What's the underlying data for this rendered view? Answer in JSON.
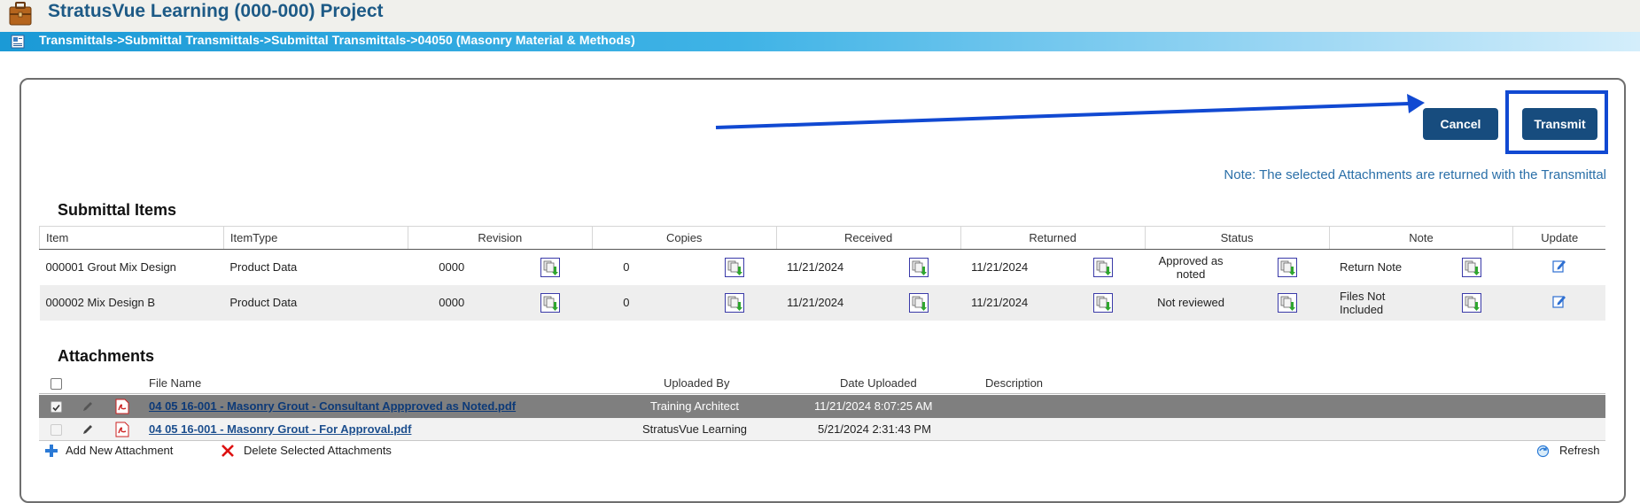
{
  "app": {
    "title": "StratusVue Learning (000-000) Project"
  },
  "breadcrumb": "Transmittals->Submittal Transmittals->Submittal Transmittals->04050 (Masonry Material & Methods)",
  "actions": {
    "cancel_label": "Cancel",
    "transmit_label": "Transmit"
  },
  "note": "Note: The selected Attachments are returned with the Transmittal",
  "submittal": {
    "title": "Submittal Items",
    "columns": [
      "Item",
      "ItemType",
      "Revision",
      "Copies",
      "Received",
      "Returned",
      "Status",
      "Note",
      "Update"
    ],
    "rows": [
      {
        "item": "000001 Grout Mix Design",
        "type": "Product Data",
        "revision": "0000",
        "copies": "0",
        "received": "11/21/2024",
        "returned": "11/21/2024",
        "status": "Approved as noted",
        "note": "Return Note"
      },
      {
        "item": "000002 Mix Design B",
        "type": "Product Data",
        "revision": "0000",
        "copies": "0",
        "received": "11/21/2024",
        "returned": "11/21/2024",
        "status": "Not reviewed",
        "note": "Files Not Included"
      }
    ]
  },
  "attachments": {
    "title": "Attachments",
    "columns": {
      "file_name": "File Name",
      "uploaded_by": "Uploaded By",
      "date_uploaded": "Date Uploaded",
      "description": "Description"
    },
    "rows": [
      {
        "file": "04 05 16-001 - Masonry Grout - Consultant Appproved as Noted.pdf",
        "uploaded_by": "Training Architect",
        "date": "11/21/2024 8:07:25 AM",
        "selected": true
      },
      {
        "file": "04 05 16-001 - Masonry Grout - For Approval.pdf",
        "uploaded_by": "StratusVue Learning",
        "date": "5/21/2024 2:31:43 PM",
        "selected": false
      }
    ],
    "add_label": "Add New Attachment",
    "delete_label": "Delete Selected Attachments",
    "refresh_label": "Refresh"
  },
  "colors": {
    "brand": "#1d5a86",
    "button": "#174c7e",
    "highlight": "#1149d2",
    "note": "#2a6fa8"
  },
  "icons": [
    "briefcase-icon",
    "document-icon",
    "import-icon",
    "edit-icon",
    "pencil-icon",
    "pdf-icon",
    "plus-icon",
    "delete-icon",
    "refresh-icon"
  ]
}
